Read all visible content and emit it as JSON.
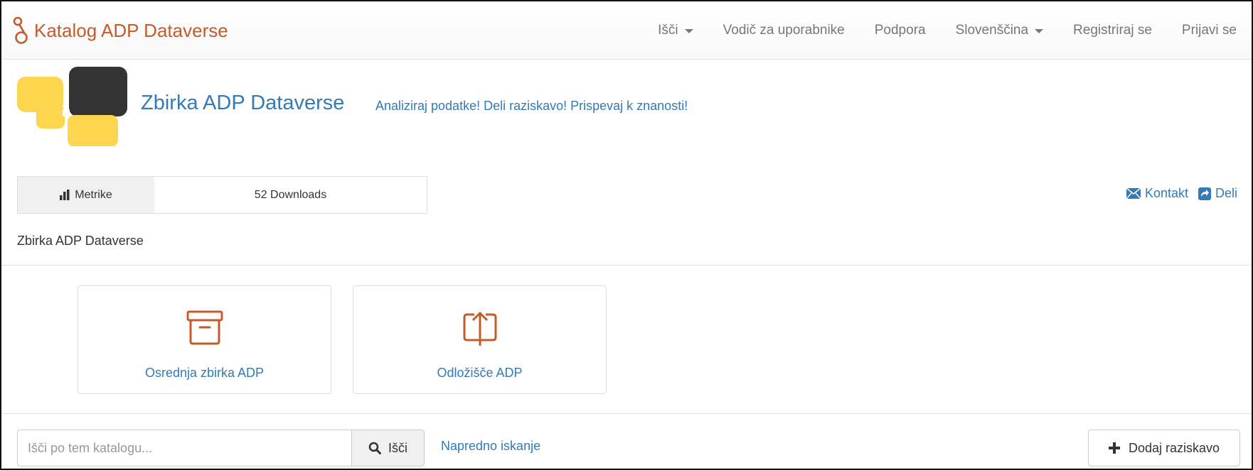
{
  "navbar": {
    "brand": "Katalog ADP Dataverse",
    "items": [
      {
        "label": "Išči",
        "dropdown": true
      },
      {
        "label": "Vodič za uporabnike",
        "dropdown": false
      },
      {
        "label": "Podpora",
        "dropdown": false
      },
      {
        "label": "Slovenščina",
        "dropdown": true
      },
      {
        "label": "Registriraj se",
        "dropdown": false
      },
      {
        "label": "Prijavi se",
        "dropdown": false
      }
    ]
  },
  "header": {
    "title": "Zbirka ADP Dataverse",
    "tagline": "Analiziraj podatke! Deli raziskavo! Prispevaj k znanosti!"
  },
  "metrics": {
    "label": "Metrike",
    "value": "52 Downloads"
  },
  "actions": {
    "contact": "Kontakt",
    "share": "Deli"
  },
  "description": "Zbirka ADP Dataverse",
  "featured": [
    {
      "label": "Osrednja zbirka ADP",
      "icon": "archive-box-icon"
    },
    {
      "label": "Odložišče ADP",
      "icon": "upload-icon"
    }
  ],
  "search": {
    "placeholder": "Išči po tem katalogu...",
    "button": "Išči",
    "advanced": "Napredno iskanje"
  },
  "add_button": "Dodaj raziskavo",
  "colors": {
    "brand": "#c55b28",
    "link": "#337ab7",
    "logo_yellow": "#fdd54f",
    "logo_dark": "#333333"
  }
}
